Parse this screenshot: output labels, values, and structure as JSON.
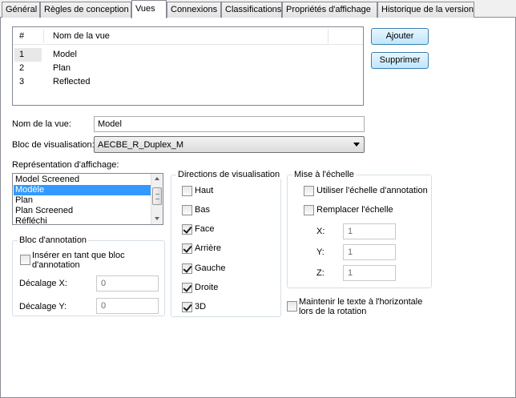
{
  "tabs": [
    "Général",
    "Règles de conception",
    "Vues",
    "Connexions",
    "Classifications",
    "Propriétés d'affichage",
    "Historique de la version"
  ],
  "active_tab": "Vues",
  "views_table": {
    "headers": [
      "#",
      "Nom de la vue"
    ],
    "rows": [
      {
        "num": "1",
        "name": "Model"
      },
      {
        "num": "2",
        "name": "Plan"
      },
      {
        "num": "3",
        "name": "Reflected"
      }
    ]
  },
  "buttons": {
    "add": "Ajouter",
    "remove": "Supprimer"
  },
  "view_name": {
    "label": "Nom de la vue:",
    "value": "Model"
  },
  "view_block": {
    "label": "Bloc de visualisation:",
    "value": "AECBE_R_Duplex_M"
  },
  "display_rep": {
    "label": "Représentation d'affichage:",
    "items": [
      "Model Screened",
      "Modèle",
      "Plan",
      "Plan Screened",
      "Réfléchi"
    ],
    "selected": "Modèle"
  },
  "annotation_block": {
    "title": "Bloc d'annotation",
    "insert_label": "Insérer en tant que bloc d'annotation",
    "offset_x_label": "Décalage X:",
    "offset_x_value": "0",
    "offset_y_label": "Décalage Y:",
    "offset_y_value": "0"
  },
  "view_directions": {
    "title": "Directions de visualisation",
    "items": [
      {
        "label": "Haut",
        "checked": false
      },
      {
        "label": "Bas",
        "checked": false
      },
      {
        "label": "Face",
        "checked": true
      },
      {
        "label": "Arrière",
        "checked": true
      },
      {
        "label": "Gauche",
        "checked": true
      },
      {
        "label": "Droite",
        "checked": true
      },
      {
        "label": "3D",
        "checked": true
      }
    ]
  },
  "scale": {
    "title": "Mise à l'échelle",
    "use_annotation_scale": "Utiliser l'échelle d'annotation",
    "override_scale": "Remplacer l'échelle",
    "x_label": "X:",
    "x_value": "1",
    "y_label": "Y:",
    "y_value": "1",
    "z_label": "Z:",
    "z_value": "1"
  },
  "keep_text_horizontal": "Maintenir le texte à l'horizontale lors de la rotation"
}
